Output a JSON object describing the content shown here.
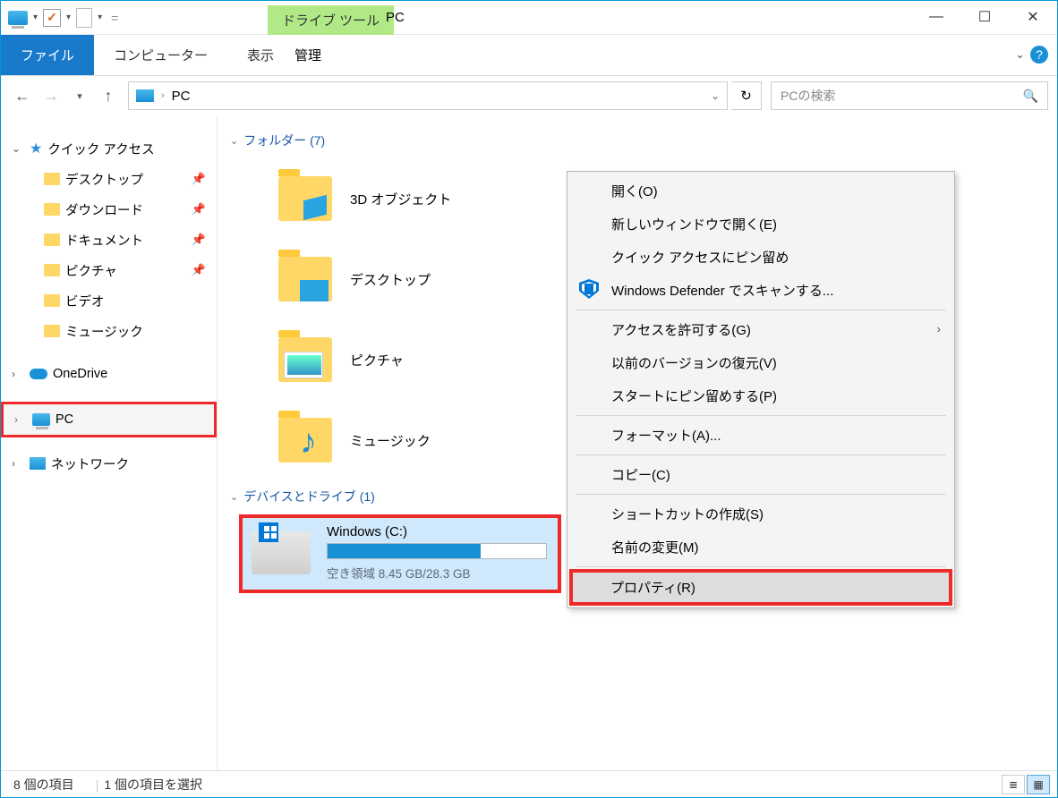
{
  "title": "PC",
  "ribbon": {
    "drive_tools": "ドライブ ツール",
    "file_tab": "ファイル",
    "computer_tab": "コンピューター",
    "view_tab": "表示",
    "manage_tab": "管理"
  },
  "address": {
    "crumb": "PC"
  },
  "search": {
    "placeholder": "PCの検索"
  },
  "sidebar": {
    "quick_access": "クイック アクセス",
    "desktop": "デスクトップ",
    "downloads": "ダウンロード",
    "documents": "ドキュメント",
    "pictures": "ピクチャ",
    "videos": "ビデオ",
    "music": "ミュージック",
    "onedrive": "OneDrive",
    "pc": "PC",
    "network": "ネットワーク"
  },
  "groups": {
    "folders_header": "フォルダー (7)",
    "drives_header": "デバイスとドライブ (1)"
  },
  "folders": {
    "objects3d": "3D オブジェクト",
    "desktop": "デスクトップ",
    "pictures": "ピクチャ",
    "music": "ミュージック"
  },
  "drive": {
    "name": "Windows (C:)",
    "free": "空き領域 8.45 GB/28.3 GB",
    "fill_percent": 70
  },
  "context_menu": {
    "open": "開く(O)",
    "open_new": "新しいウィンドウで開く(E)",
    "pin_quick": "クイック アクセスにピン留め",
    "defender": "Windows Defender でスキャンする...",
    "grant_access": "アクセスを許可する(G)",
    "restore": "以前のバージョンの復元(V)",
    "pin_start": "スタートにピン留めする(P)",
    "format": "フォーマット(A)...",
    "copy": "コピー(C)",
    "make_shortcut": "ショートカットの作成(S)",
    "rename": "名前の変更(M)",
    "properties": "プロパティ(R)"
  },
  "status": {
    "items": "8 個の項目",
    "selected": "1 個の項目を選択"
  }
}
